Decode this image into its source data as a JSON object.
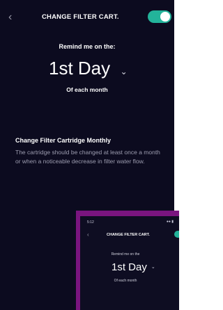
{
  "header": {
    "back_icon": "chevron-left-icon",
    "title": "CHANGE FILTER CART.",
    "toggle_on": true,
    "accent": "#23b39a"
  },
  "schedule": {
    "remind_label": "Remind me on the:",
    "day_value": "1st Day",
    "chevron_icon": "chevron-down-icon",
    "each_label": "Of each month"
  },
  "info": {
    "title": "Change Filter Cartridge Monthly",
    "body": "The cartridge should be changed at least once a month or when a noticeable decrease in filter water flow."
  },
  "inset": {
    "status_time": "5:12",
    "title": "CHANGE FILTER CART.",
    "remind_label": "Remind me on the",
    "day_value": "1st Day",
    "each_label": "Of each month",
    "frame_color": "#7a157f"
  }
}
